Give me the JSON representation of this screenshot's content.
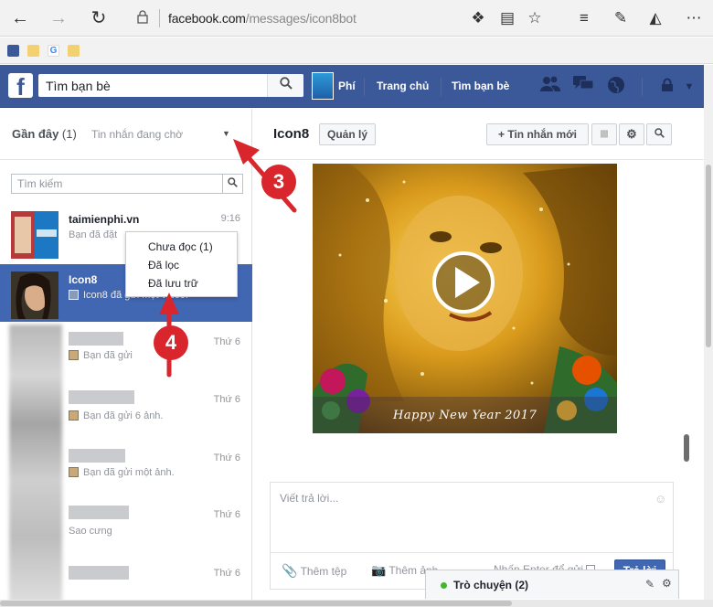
{
  "browser": {
    "url_domain": "facebook.com",
    "url_path": "/messages/icon8bot"
  },
  "facebook": {
    "logo_letter": "f",
    "search_placeholder": "Tìm bạn bè",
    "nav": {
      "free": "Phí",
      "home": "Trang chủ",
      "find_friends": "Tìm bạn bè"
    }
  },
  "sidebar": {
    "recent_label": "Gần đây",
    "recent_count": "(1)",
    "pending_label": "Tin nhắn đang chờ",
    "search_placeholder": "Tìm kiếm",
    "conversations": [
      {
        "name": "taimienphi.vn",
        "snippet": "Bạn đã đặt",
        "time": "9:16"
      },
      {
        "name": "Icon8",
        "snippet": "Icon8 đã gửi một video.",
        "time": ""
      },
      {
        "name": "",
        "snippet": "Bạn đã gửi",
        "time": "Thứ 6"
      },
      {
        "name": "",
        "snippet": "Bạn đã gửi 6 ảnh.",
        "time": "Thứ 6"
      },
      {
        "name": "",
        "snippet": "Bạn đã gửi một ảnh.",
        "time": "Thứ 6"
      },
      {
        "name": "",
        "snippet": "Sao cưng",
        "time": "Thứ 6"
      },
      {
        "name": "",
        "snippet": "",
        "time": "Thứ 6"
      }
    ]
  },
  "dropdown": {
    "items": [
      "Chưa đọc (1)",
      "Đã lọc",
      "Đã lưu trữ"
    ]
  },
  "annotations": {
    "step3": "3",
    "step4": "4"
  },
  "thread": {
    "title": "Icon8",
    "manage_label": "Quản lý",
    "new_message_label": "Tin nhắn mới",
    "video_caption": "Happy New Year 2017"
  },
  "composer": {
    "placeholder": "Viết trả lời...",
    "add_files": "Thêm tệp",
    "add_photos": "Thêm ảnh",
    "enter_to_send": "Nhấn Enter để gửi",
    "reply_label": "Trả lời"
  },
  "chat": {
    "label": "Trò chuyện (2)"
  },
  "colors": {
    "fb_blue": "#3b5998",
    "active_row": "#4267b2",
    "annotation_red": "#d9262c"
  }
}
